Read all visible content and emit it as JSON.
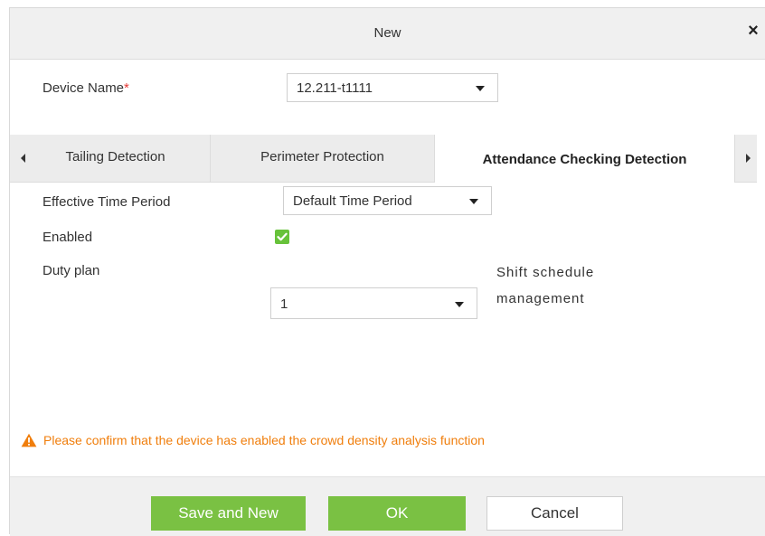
{
  "dialog": {
    "title": "New",
    "close_symbol": "×"
  },
  "device": {
    "label": "Device Name",
    "required_mark": "*",
    "selected": "12.211-t1111"
  },
  "tabs": [
    {
      "label": "Tailing Detection",
      "active": false
    },
    {
      "label": "Perimeter Protection",
      "active": false
    },
    {
      "label": "Attendance Checking Detection",
      "active": true
    }
  ],
  "form": {
    "time_period_label": "Effective Time Period",
    "time_period_value": "Default Time Period",
    "enabled_label": "Enabled",
    "enabled_checked": true,
    "duty_plan_label": "Duty plan",
    "duty_plan_value": "1",
    "shift_link_line1": "Shift schedule",
    "shift_link_line2": "management"
  },
  "warning": {
    "text": "Please confirm that the device has enabled the crowd density analysis function",
    "color": "#f07e0c",
    "icon": "warning-triangle-icon"
  },
  "buttons": {
    "save_and_new": "Save and New",
    "ok": "OK",
    "cancel": "Cancel"
  },
  "colors": {
    "primary_green": "#7ac143",
    "checkbox_green": "#67c23a",
    "required_red": "#e53935"
  }
}
